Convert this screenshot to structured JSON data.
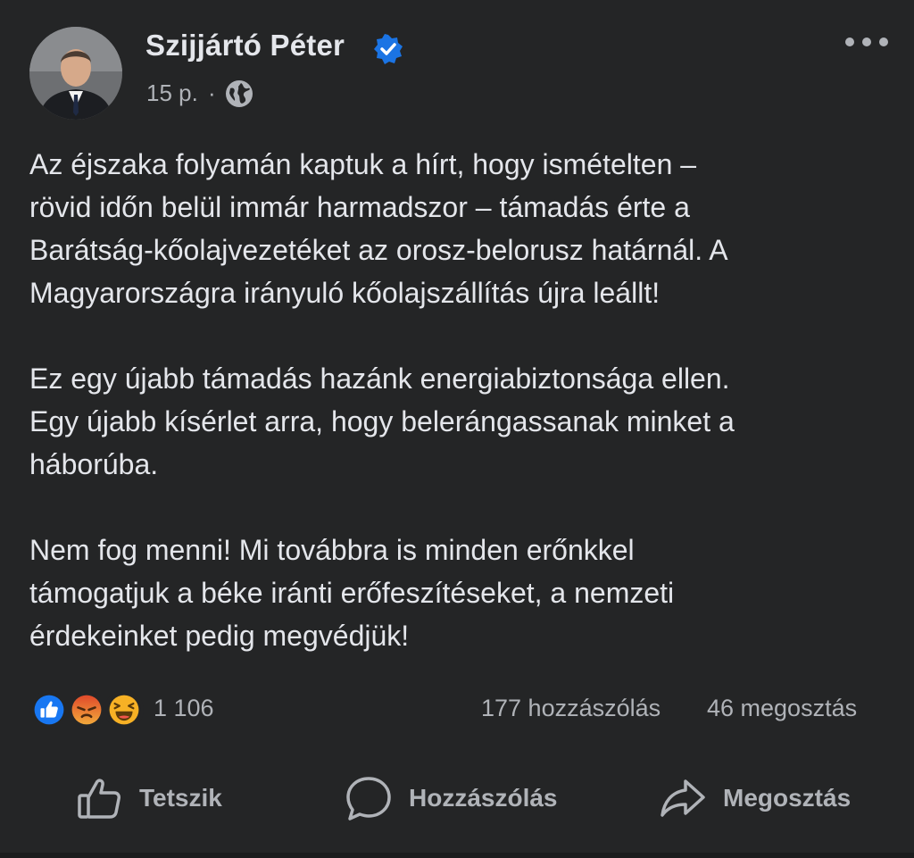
{
  "post": {
    "author": "Szijjártó Péter",
    "verified": true,
    "time": "15 p.",
    "separator": "·",
    "audience_icon": "globe-icon",
    "more_icon": "more-options-icon",
    "paragraphs": [
      "Az éjszaka folyamán kaptuk a hírt, hogy ismételten –\nrövid időn belül immár harmadszor – támadás érte a\nBarátság-kőolajvezetéket az orosz-belorusz határnál. A\nMagyarországra irányuló kőolajszállítás újra leállt!",
      "Ez egy újabb támadás hazánk energiabiztonsága ellen.\nEgy újabb kísérlet arra, hogy belerángassanak minket a\nháborúba.",
      "Nem fog menni! Mi továbbra is minden erőnkkel\ntámogatjuk a béke iránti erőfeszítéseket, a nemzeti\nérdekeinket pedig megvédjük!"
    ]
  },
  "stats": {
    "reaction_icons": [
      "like-reaction-icon",
      "angry-reaction-icon",
      "haha-reaction-icon"
    ],
    "reaction_count": "1 106",
    "comments": "177 hozzászólás",
    "shares": "46 megosztás"
  },
  "actions": {
    "like": "Tetszik",
    "comment": "Hozzászólás",
    "share": "Megosztás"
  },
  "colors": {
    "background": "#242526",
    "text": "#e4e6eb",
    "secondary_text": "#b0b3b8",
    "verified_blue": "#1b74e4",
    "like_blue": "#1877f2",
    "angry_orange": "#e9710f",
    "haha_yellow": "#f7b125"
  }
}
